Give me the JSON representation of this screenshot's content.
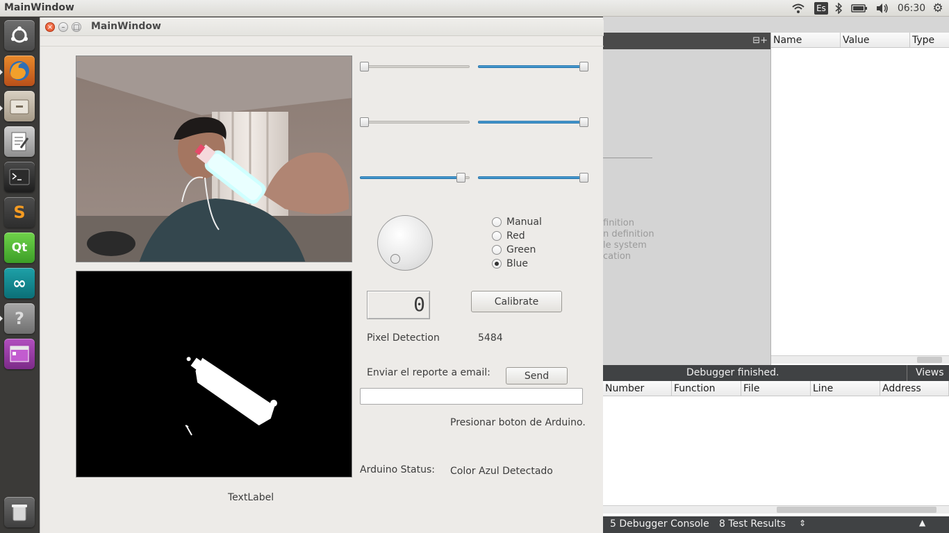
{
  "top_panel": {
    "title": "MainWindow",
    "keyboard_layout": "Es",
    "clock": "06:30"
  },
  "launcher": {
    "items": [
      {
        "name": "ubuntu-dash-icon",
        "label": ""
      },
      {
        "name": "firefox-icon",
        "label": ""
      },
      {
        "name": "files-icon",
        "label": ""
      },
      {
        "name": "text-editor-icon",
        "label": ""
      },
      {
        "name": "terminal-icon",
        "label": ""
      },
      {
        "name": "sublime-text-icon",
        "label": "S"
      },
      {
        "name": "qt-creator-icon",
        "label": "Qt"
      },
      {
        "name": "arduino-icon",
        "label": "∞"
      },
      {
        "name": "help-icon",
        "label": "?"
      },
      {
        "name": "workspace-icon",
        "label": ""
      },
      {
        "name": "trash-icon",
        "label": ""
      }
    ]
  },
  "window": {
    "title": "MainWindow"
  },
  "controls": {
    "sliders": [
      {
        "name": "slider-left-1",
        "value": 0.0
      },
      {
        "name": "slider-right-1",
        "value": 1.0
      },
      {
        "name": "slider-left-2",
        "value": 0.0
      },
      {
        "name": "slider-right-2",
        "value": 1.0
      },
      {
        "name": "slider-left-3",
        "value": 0.9
      },
      {
        "name": "slider-right-3",
        "value": 1.0
      }
    ],
    "radios": [
      {
        "label": "Manual",
        "checked": false
      },
      {
        "label": "Red",
        "checked": false
      },
      {
        "label": "Green",
        "checked": false
      },
      {
        "label": "Blue",
        "checked": true
      }
    ],
    "lcd_value": "0",
    "calibrate_label": "Calibrate",
    "pixel_detection_label": "Pixel Detection",
    "pixel_detection_value": "5484",
    "email_label": "Enviar el reporte a email:",
    "send_label": "Send",
    "email_value": "",
    "instruction": "Presionar boton de Arduino.",
    "arduino_status_label": "Arduino Status:",
    "arduino_status_value": "Color Azul Detectado",
    "text_label": "TextLabel"
  },
  "background_app": {
    "locals_headers": [
      "Name",
      "Value",
      "Type"
    ],
    "debugger_message": "Debugger finished.",
    "views_label": "Views",
    "stack_headers": [
      "Number",
      "Function",
      "File",
      "Line",
      "Address"
    ],
    "ghost_lines": [
      "finition",
      "n definition",
      "le system",
      "cation"
    ],
    "status_items": [
      "5  Debugger Console",
      "8  Test Results"
    ]
  },
  "colors": {
    "slider_fill": "#2e86c1",
    "close_button": "#e0451b",
    "window_bg": "#edebe8"
  }
}
